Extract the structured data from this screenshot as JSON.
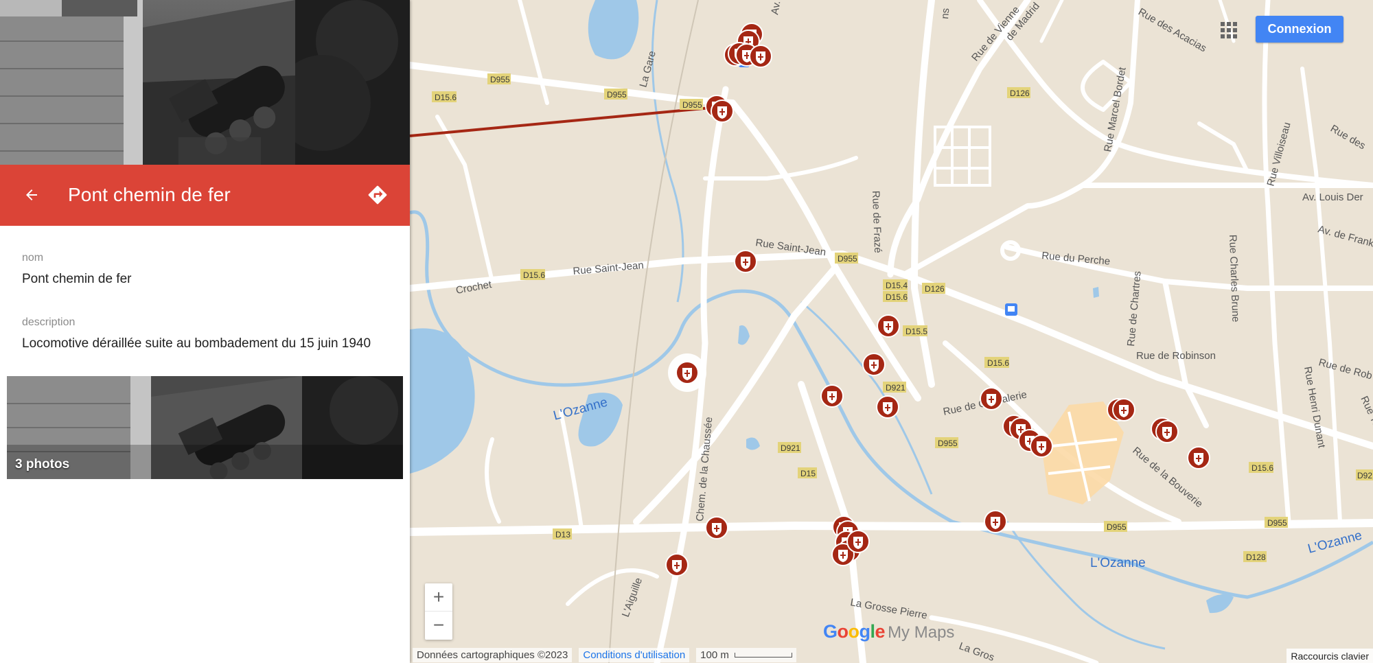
{
  "panel": {
    "title": "Pont chemin de fer",
    "fields": {
      "nom_label": "nom",
      "nom_value": "Pont chemin de fer",
      "description_label": "description",
      "description_value": "Locomotive déraillée suite au bombadement du 15 juin 1940"
    },
    "photos": {
      "count_label": "3 photos"
    }
  },
  "map": {
    "signin_label": "Connexion",
    "zoom_in": "+",
    "zoom_out": "−",
    "brand": {
      "google": "Google",
      "my_maps": "My Maps"
    },
    "footer": {
      "data": "Données cartographiques ©2023",
      "terms": "Conditions d'utilisation",
      "scale": "100 m",
      "shortcuts": "Raccourcis clavier"
    },
    "street_labels": [
      "Rue des Acacias",
      "Rue de Vienne",
      "de Madrid",
      "Rue des",
      "Av. Louis Der",
      "Av. de Frankenberg",
      "Rue Marcel Bordet",
      "Rue Villoiseau",
      "Rue de Frazé",
      "Rue du Perche",
      "Rue Saint-Jean",
      "Crochet",
      "La Gare",
      "Rue de Chartres",
      "Rue Charles Brune",
      "Rue de Robinson",
      "Rue de Rob",
      "Rue Henri Dunant",
      "Rue Thiers",
      "Rue de Chevalerie",
      "Rue de la Bouverie",
      "Chem. de la Chaussée",
      "L'Aiguille",
      "La Grosse Pierre",
      "Av.",
      "La Gros",
      "ns"
    ],
    "water_labels": [
      "L'Ozanne",
      "L'Ozanne",
      "L'Ozanne"
    ],
    "road_badges": [
      "D15.6",
      "D955",
      "D955",
      "D955",
      "D126",
      "D955",
      "D15.6",
      "D15.4",
      "D15.6",
      "D126",
      "D15.5",
      "D15.6",
      "D921",
      "D955",
      "D921",
      "D15",
      "D13",
      "D955",
      "D955",
      "D15.6",
      "D128",
      "D92"
    ],
    "colors": {
      "header": "#db4437",
      "signin": "#4285f4",
      "route": "#a52714",
      "pin": "#a52714"
    },
    "icons": [
      "back-arrow-icon",
      "directions-icon",
      "apps-grid-icon",
      "pin-icon"
    ]
  }
}
